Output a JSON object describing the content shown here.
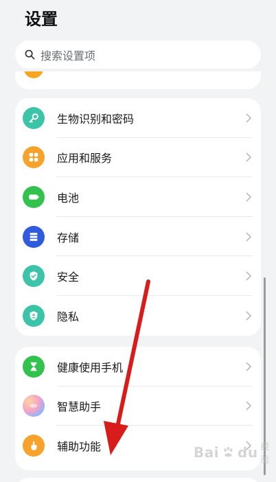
{
  "header": {
    "title": "设置"
  },
  "search": {
    "placeholder": "搜索设置项"
  },
  "group1": [
    {
      "label": "生物识别和密码",
      "icon": "key-icon",
      "color": "#3cc4a9"
    },
    {
      "label": "应用和服务",
      "icon": "apps-grid-icon",
      "color": "#f7a22b"
    },
    {
      "label": "电池",
      "icon": "battery-icon",
      "color": "#32c24d"
    },
    {
      "label": "存储",
      "icon": "storage-icon",
      "color": "#2f5bde"
    },
    {
      "label": "安全",
      "icon": "shield-check-icon",
      "color": "#3cc4a9"
    },
    {
      "label": "隐私",
      "icon": "privacy-icon",
      "color": "#3cc4a9"
    }
  ],
  "group2": [
    {
      "label": "健康使用手机",
      "icon": "hourglass-icon",
      "color": "#32c24d"
    },
    {
      "label": "智慧助手",
      "icon": "assistant-icon",
      "color": "#b58cf0"
    },
    {
      "label": "辅助功能",
      "icon": "hand-icon",
      "color": "#f7a22b"
    }
  ],
  "watermark": {
    "brand": "Bai",
    "brand2": "du",
    "sub": "经验"
  },
  "annotation": {
    "arrow_color": "#d81b1b"
  }
}
